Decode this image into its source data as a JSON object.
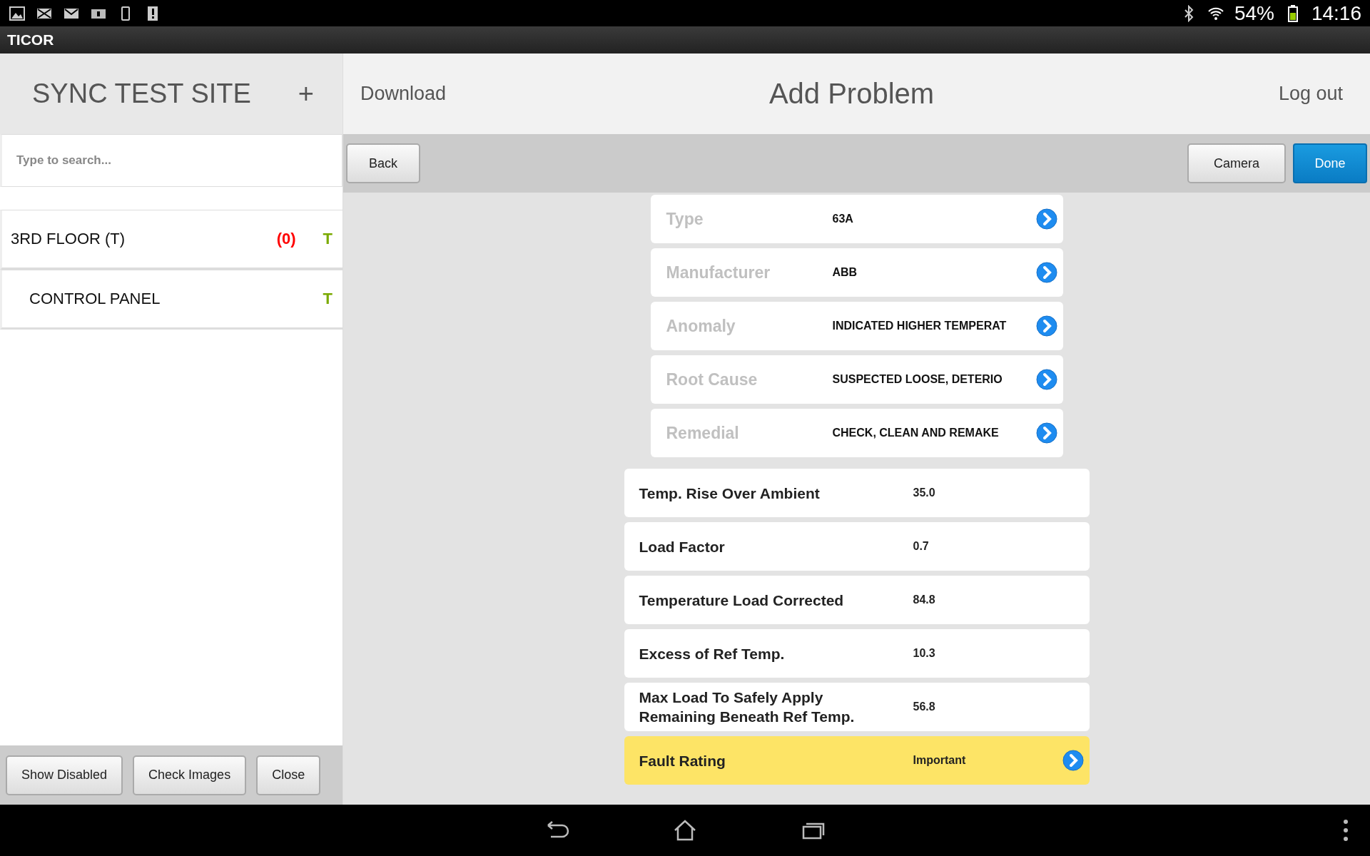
{
  "status_bar": {
    "battery_percent": "54%",
    "time": "14:16"
  },
  "app_title": "TICOR",
  "sidebar": {
    "site_title": "SYNC TEST SITE",
    "add_label": "+",
    "search": {
      "placeholder": "Type to search..."
    },
    "items": [
      {
        "name": "3RD FLOOR (T)",
        "count": "(0)",
        "flag": "T",
        "children": [
          {
            "name": "CONTROL PANEL",
            "flag": "T"
          }
        ]
      }
    ],
    "buttons": [
      "Show Disabled",
      "Check Images",
      "Close"
    ]
  },
  "header": {
    "download": "Download",
    "title": "Add Problem",
    "logout": "Log out"
  },
  "toolbar": {
    "back": "Back",
    "camera": "Camera",
    "done": "Done"
  },
  "pickers": [
    {
      "label": "Type",
      "value": "63A"
    },
    {
      "label": "Manufacturer",
      "value": "ABB"
    },
    {
      "label": "Anomaly",
      "value": "INDICATED HIGHER TEMPERAT"
    },
    {
      "label": "Root Cause",
      "value": "SUSPECTED LOOSE, DETERIO"
    },
    {
      "label": "Remedial",
      "value": "CHECK, CLEAN AND REMAKE"
    }
  ],
  "fields": [
    {
      "label": "Temp. Rise Over Ambient",
      "value": "35.0",
      "highlighted": false,
      "arrow": false
    },
    {
      "label": "Load Factor",
      "value": "0.7",
      "highlighted": false,
      "arrow": false
    },
    {
      "label": "Temperature Load Corrected",
      "value": "84.8",
      "highlighted": false,
      "arrow": false
    },
    {
      "label": "Excess of Ref Temp.",
      "value": "10.3",
      "highlighted": false,
      "arrow": false
    },
    {
      "label": "Max Load To Safely Apply\nRemaining Beneath Ref Temp.",
      "value": "56.8",
      "highlighted": false,
      "arrow": false
    },
    {
      "label": "Fault Rating",
      "value": "Important",
      "highlighted": true,
      "arrow": true
    }
  ]
}
